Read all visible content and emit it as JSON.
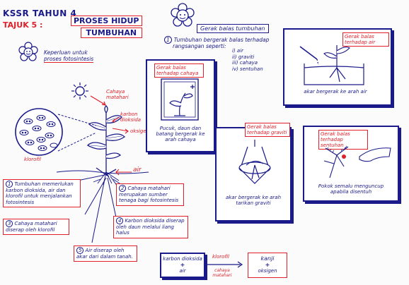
{
  "header": {
    "title": "KSSR TAHUN 4",
    "subtitle_label": "TAJUK 5 :",
    "topic_line1": "PROSES HIDUP",
    "topic_line2": "TUMBUHAN"
  },
  "left": {
    "heading_line1": "Keperluan untuk",
    "heading_line2": "proses fotosintesis",
    "labels": {
      "cahaya": "Cahaya",
      "matahari": "matahari",
      "karbon": "karbon",
      "dioksida": "dioksida",
      "oksigen": "oksigen",
      "klorofil": "klorofil",
      "air": "air"
    },
    "steps": [
      {
        "num": "1",
        "text": "Tumbuhan memerlukan karbon dioksida, air dan klorofil untuk menjalankan fotosintesis"
      },
      {
        "num": "2",
        "text": "Cahaya matahari merupakan sumber tenaga bagi fotosintesis"
      },
      {
        "num": "3",
        "text": "Cahaya matahari diserap oleh klorofil"
      },
      {
        "num": "4",
        "text": "Karbon dioksida diserap oleh daun melalui liang halus"
      },
      {
        "num": "5",
        "text": "Air diserap oleh akar dari dalam tanah."
      }
    ]
  },
  "right": {
    "heading": "Gerak balas tumbuhan",
    "intro_num": "1",
    "intro_line1": "Tumbuhan bergerak balas terhadap",
    "intro_line2": "rangsangan seperti:",
    "stimuli": [
      "i) air",
      "ii) graviti",
      "iii) cahaya",
      "iv) sentuhan"
    ],
    "cards": {
      "air": {
        "tag": "Gerak balas terhadap air",
        "caption": "akar bergerak ke arah air"
      },
      "cahaya": {
        "tag": "Gerak balas terhadap cahaya",
        "caption": "Pucuk, daun dan batang bergerak ke arah cahaya"
      },
      "graviti": {
        "tag": "Gerak balas terhadap graviti",
        "caption": "akar bergerak ke arah tarikan graviti"
      },
      "sentuhan": {
        "tag": "Gerak balas terhadap sentuhan",
        "caption": "Pokok semalu menguncup apabila disentuh"
      }
    },
    "equation": {
      "left_top": "karbon dioksida",
      "plus": "+",
      "left_bottom": "air",
      "arrow_top": "klorofil",
      "arrow_bottom": "cahaya matahari",
      "right_top": "kanji",
      "right_bottom": "oksigen"
    }
  }
}
